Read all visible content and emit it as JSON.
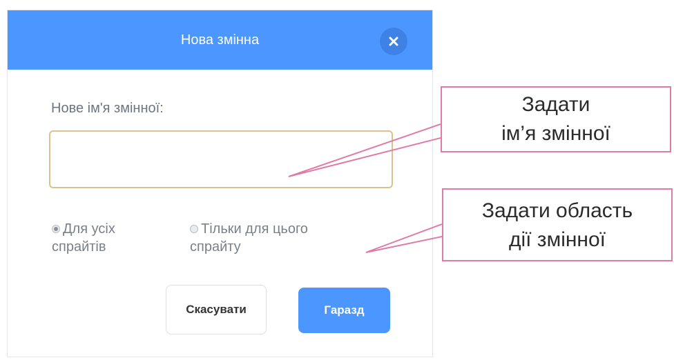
{
  "dialog": {
    "title": "Нова змінна",
    "close_icon": "close-icon",
    "field_label": "Нове ім'я змінної:",
    "name_input": {
      "value": "",
      "placeholder": ""
    },
    "scope_options": [
      {
        "line1": "Для усіх",
        "line2": "спрайтів",
        "selected": true
      },
      {
        "line1": "Тільки для цього",
        "line2": "спрайту",
        "selected": false
      }
    ],
    "cancel_label": "Скасувати",
    "ok_label": "Гаразд"
  },
  "annotations": {
    "callout_name": {
      "line1": "Задати",
      "line2": "ім’я змінної"
    },
    "callout_scope": {
      "line1": "Задати область",
      "line2": "дії змінної"
    }
  },
  "colors": {
    "header": "#4c97ff",
    "ok_button": "#4c97ff",
    "input_border": "#d9c38a",
    "callout_border": "#e07aa6"
  }
}
